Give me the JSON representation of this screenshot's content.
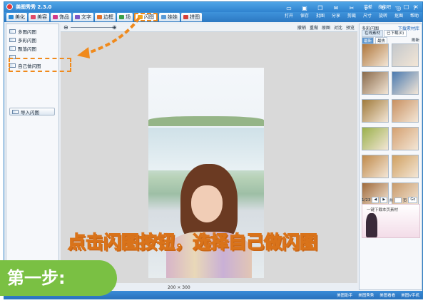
{
  "app": {
    "title": "美图秀秀 2.3.0",
    "links": [
      "菜单",
      "技能吧"
    ],
    "window_controls": [
      "minimize-icon",
      "maximize-icon",
      "close-icon"
    ]
  },
  "toolbar": {
    "tabs": [
      {
        "label": "美化",
        "icon": "beautify-icon",
        "color": "#2a8ad6"
      },
      {
        "label": "美容",
        "icon": "face-icon",
        "color": "#e04a6a"
      },
      {
        "label": "饰品",
        "icon": "accessory-icon",
        "color": "#d23a8a"
      },
      {
        "label": "文字",
        "icon": "text-icon",
        "color": "#7b56c6"
      },
      {
        "label": "边框",
        "icon": "frame-icon",
        "color": "#e0702a"
      },
      {
        "label": "场",
        "icon": "scene-icon",
        "color": "#3aa04a"
      },
      {
        "label": "闪图",
        "icon": "flash-icon",
        "color": "#f0a21c",
        "active": true
      },
      {
        "label": "娃娃",
        "icon": "doll-icon",
        "color": "#5a9ad6"
      },
      {
        "label": "拼图",
        "icon": "puzzle-icon",
        "color": "#d6403a"
      }
    ],
    "tools": [
      {
        "label": "打开",
        "icon": "folder-icon"
      },
      {
        "label": "保存",
        "icon": "save-icon"
      },
      {
        "label": "批图",
        "icon": "batch-icon"
      },
      {
        "label": "分享",
        "icon": "share-icon"
      },
      {
        "label": "剪裁",
        "icon": "crop-icon"
      },
      {
        "label": "尺寸",
        "icon": "resize-icon"
      },
      {
        "label": "旋转",
        "icon": "rotate-icon"
      },
      {
        "label": "抠图",
        "icon": "cutout-icon"
      },
      {
        "label": "帮助",
        "icon": "help-icon"
      }
    ]
  },
  "left_panel": {
    "items": [
      "多图闪图",
      "多彩闪图",
      "飘落闪图",
      "",
      "自己做闪图"
    ],
    "import_button": "导入闪图"
  },
  "canvas_toolbar": {
    "tools": [
      "撤销",
      "重做",
      "原图",
      "对比",
      "预览"
    ]
  },
  "canvas": {
    "size_label": "200 × 300"
  },
  "right_panel": {
    "heading": "多彩闪图",
    "download_link": "下载素材库",
    "tabs": [
      "在线素材",
      "已下载(0)"
    ],
    "subtabs": [
      "最新",
      "最热"
    ],
    "filter": "刷新",
    "thumbnails": [
      "#b0773c",
      "#c4c8cc",
      "#8a6a4a",
      "#4a7ab0",
      "#a07a3a",
      "#c89060",
      "#9ab04a",
      "#d4a070",
      "#c08a4a",
      "#d0a060",
      "#a06a3a",
      "#c89a6a"
    ],
    "pager": {
      "current": "1/23",
      "total_label": "共",
      "page_label": "页",
      "go": "Go"
    },
    "promo_text": "一键下载本页素材"
  },
  "status_bar": {
    "items": [
      "美图助手",
      "美图秀秀",
      "美图看看",
      "美图V手机"
    ]
  },
  "overlay": {
    "step_label": "第一步:",
    "caption": "点击闪图按钮，选择自己做闪图"
  }
}
